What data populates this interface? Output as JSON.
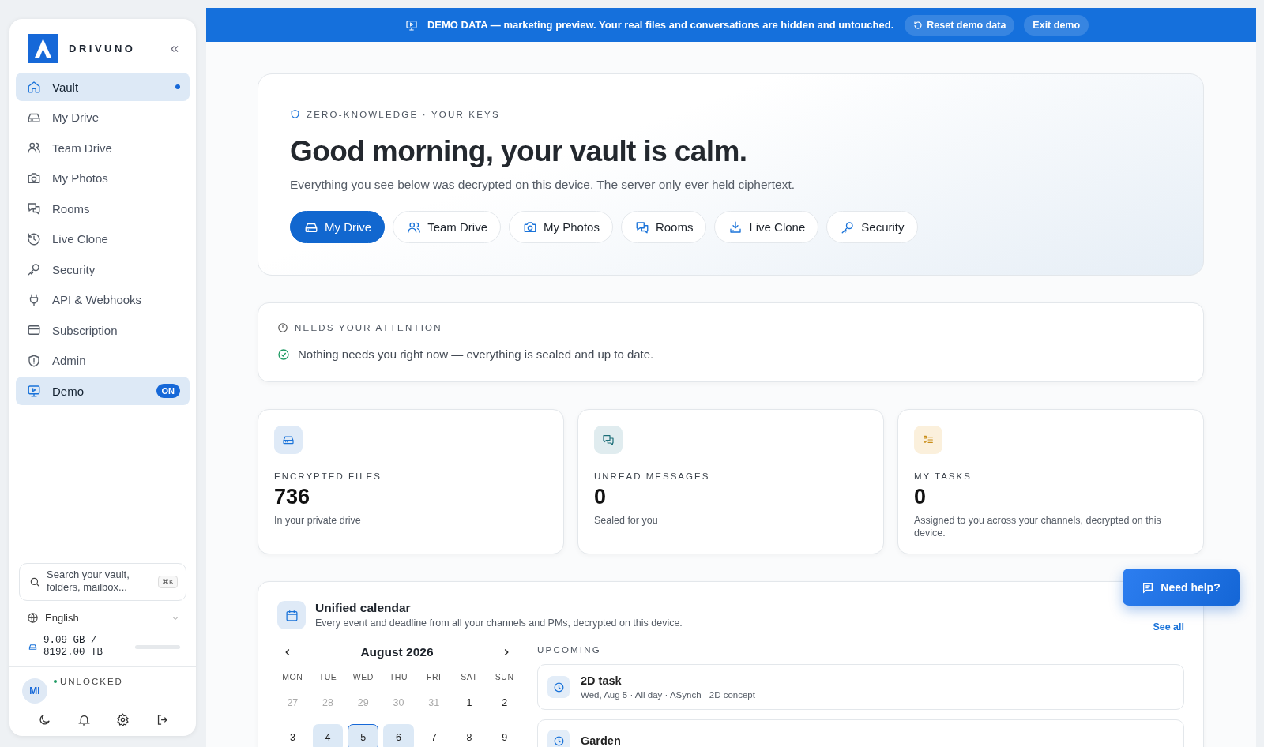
{
  "brand": {
    "name": "DRIVUNO"
  },
  "sidebar": {
    "items": [
      {
        "label": "Vault",
        "selected": true,
        "unread": true
      },
      {
        "label": "My Drive",
        "selected": false,
        "unread": false
      },
      {
        "label": "Team Drive",
        "selected": false,
        "unread": false
      },
      {
        "label": "My Photos",
        "selected": false,
        "unread": false
      },
      {
        "label": "Rooms",
        "selected": false,
        "unread": false
      },
      {
        "label": "Live Clone",
        "selected": false,
        "unread": false
      },
      {
        "label": "Security",
        "selected": false,
        "unread": false
      },
      {
        "label": "API & Webhooks",
        "selected": false,
        "unread": false
      },
      {
        "label": "Subscription",
        "selected": false,
        "unread": false
      },
      {
        "label": "Admin",
        "selected": false,
        "unread": false
      },
      {
        "label": "Demo",
        "selected": true,
        "unread": false,
        "badge": "ON"
      }
    ],
    "search": {
      "placeholder": "Search your vault, folders, mailbox...",
      "shortcut": "⌘K"
    },
    "language": "English",
    "storage": {
      "text": "9.09 GB / 8192.00 TB",
      "level": 0.001
    },
    "user": {
      "initials": "MI",
      "status": "UNLOCKED"
    }
  },
  "banner": {
    "text": "DEMO DATA — marketing preview. Your real files and conversations are hidden and untouched.",
    "buttons": [
      "Reset demo data",
      "Exit demo"
    ]
  },
  "hero": {
    "eyebrow": "ZERO-KNOWLEDGE · YOUR KEYS",
    "title": "Good morning, your vault is calm.",
    "subtitle": "Everything you see below was decrypted on this device. The server only ever held ciphertext.",
    "shortcuts": [
      {
        "label": "My Drive",
        "selected": true
      },
      {
        "label": "Team Drive",
        "selected": false
      },
      {
        "label": "My Photos",
        "selected": false
      },
      {
        "label": "Rooms",
        "selected": false
      },
      {
        "label": "Live Clone",
        "selected": false
      },
      {
        "label": "Security",
        "selected": false
      }
    ]
  },
  "attention": {
    "title": "NEEDS YOUR ATTENTION",
    "message": "Nothing needs you right now — everything is sealed and up to date."
  },
  "stats": [
    {
      "label": "ENCRYPTED FILES",
      "value": "736",
      "caption": "In your private drive"
    },
    {
      "label": "UNREAD MESSAGES",
      "value": "0",
      "caption": "Sealed for you"
    },
    {
      "label": "MY TASKS",
      "value": "0",
      "caption": "Assigned to you across your channels, decrypted on this device."
    }
  ],
  "calendar": {
    "title": "Unified calendar",
    "subtitle": "Every event and deadline from all your channels and PMs, decrypted on this device.",
    "see_all": "See all",
    "month": "August 2026",
    "weekdays": [
      "MON",
      "TUE",
      "WED",
      "THU",
      "FRI",
      "SAT",
      "SUN"
    ],
    "days": [
      {
        "label": "27",
        "muted": true,
        "marked": false,
        "selected": false
      },
      {
        "label": "28",
        "muted": true,
        "marked": false,
        "selected": false
      },
      {
        "label": "29",
        "muted": true,
        "marked": false,
        "selected": false
      },
      {
        "label": "30",
        "muted": true,
        "marked": false,
        "selected": false
      },
      {
        "label": "31",
        "muted": true,
        "marked": false,
        "selected": false
      },
      {
        "label": "1",
        "muted": false,
        "marked": false,
        "selected": false
      },
      {
        "label": "2",
        "muted": false,
        "marked": false,
        "selected": false
      },
      {
        "label": "3",
        "muted": false,
        "marked": false,
        "selected": false
      },
      {
        "label": "4",
        "muted": false,
        "marked": true,
        "selected": false
      },
      {
        "label": "5",
        "muted": false,
        "marked": true,
        "selected": true
      },
      {
        "label": "6",
        "muted": false,
        "marked": true,
        "selected": false
      },
      {
        "label": "7",
        "muted": false,
        "marked": false,
        "selected": false
      },
      {
        "label": "8",
        "muted": false,
        "marked": false,
        "selected": false
      },
      {
        "label": "9",
        "muted": false,
        "marked": false,
        "selected": false
      }
    ],
    "upcoming_title": "UPCOMING",
    "events": [
      {
        "title": "2D task",
        "meta": "Wed, Aug 5 · All day · ASynch - 2D concept"
      },
      {
        "title": "Garden"
      }
    ]
  },
  "help_button": "Need help?"
}
